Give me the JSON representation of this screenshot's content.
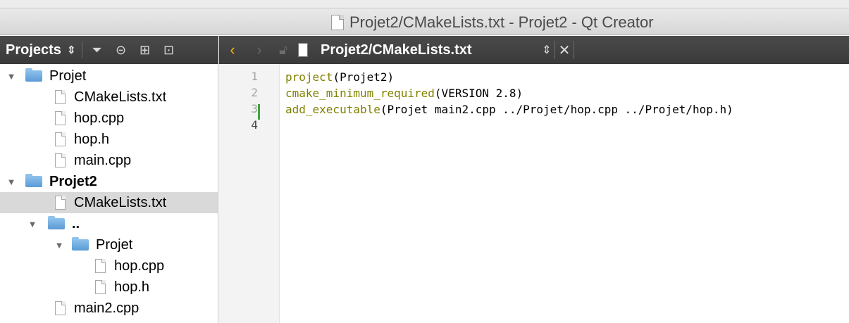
{
  "window": {
    "title": "Projet2/CMakeLists.txt - Projet2 - Qt Creator"
  },
  "sidebar": {
    "selector_label": "Projects",
    "icons": [
      "up-down-icon",
      "filter-icon",
      "link-icon",
      "split-icon",
      "close-pane-icon"
    ],
    "tree": [
      {
        "label": "Projet",
        "type": "folder",
        "depth": 0,
        "expanded": true,
        "bold": false
      },
      {
        "label": "CMakeLists.txt",
        "type": "file",
        "depth": 1
      },
      {
        "label": "hop.cpp",
        "type": "file",
        "depth": 1
      },
      {
        "label": "hop.h",
        "type": "file",
        "depth": 1
      },
      {
        "label": "main.cpp",
        "type": "file",
        "depth": 1
      },
      {
        "label": "Projet2",
        "type": "folder",
        "depth": 0,
        "expanded": true,
        "bold": true
      },
      {
        "label": "CMakeLists.txt",
        "type": "file",
        "depth": 1,
        "selected": true
      },
      {
        "label": "..",
        "type": "folder",
        "depth": 1,
        "expanded": true
      },
      {
        "label": "Projet",
        "type": "folder",
        "depth": 2,
        "expanded": true
      },
      {
        "label": "hop.cpp",
        "type": "file",
        "depth": 3
      },
      {
        "label": "hop.h",
        "type": "file",
        "depth": 3
      },
      {
        "label": "main2.cpp",
        "type": "file",
        "depth": 1
      }
    ]
  },
  "editor": {
    "file_name": "Projet2/CMakeLists.txt",
    "line_numbers": [
      "1",
      "2",
      "3",
      "4"
    ],
    "lines": [
      {
        "func": "project",
        "args": "(Projet2)"
      },
      {
        "func": "cmake_minimum_required",
        "args": "(VERSION 2.8)"
      },
      {
        "func": "add_executable",
        "args": "(Projet main2.cpp ../Projet/hop.cpp ../Projet/hop.h)"
      },
      {
        "func": "",
        "args": ""
      }
    ]
  },
  "colors": {
    "keyword": "#808000",
    "nav_back": "#f2b400",
    "change_marker": "#3aa83a"
  }
}
